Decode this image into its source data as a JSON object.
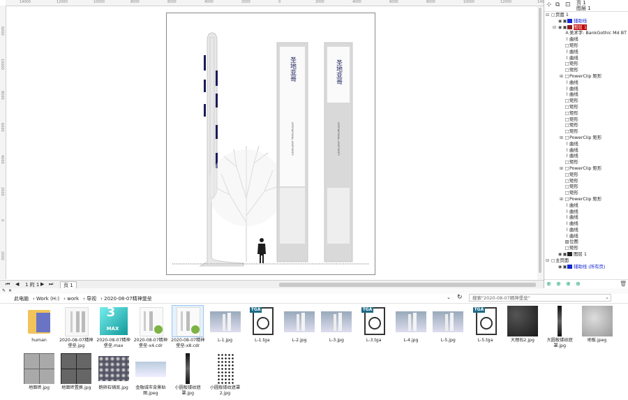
{
  "ruler": {
    "top_ticks": [
      "14000",
      "12000",
      "10000",
      "8000",
      "6000",
      "4000",
      "2000",
      "0",
      "2000",
      "4000",
      "6000",
      "8000",
      "10000",
      "12000",
      "14000"
    ],
    "left_ticks": [
      "6000",
      "10000",
      "8000",
      "6000",
      "4000",
      "2000",
      "0",
      "2000"
    ]
  },
  "navigator": {
    "page_counter": "1 的 1",
    "page_tab": "页 1"
  },
  "object_manager": {
    "page_label": "页 1",
    "layer_label": "图层 1",
    "rows": [
      {
        "indent": 0,
        "icon": "page",
        "label": "页面 1",
        "expand": "⊟"
      },
      {
        "indent": 1,
        "icon": "layer",
        "label": "辅助线",
        "swatch": "#1428d0",
        "color": "#1428d0"
      },
      {
        "indent": 1,
        "icon": "layer",
        "label": "图层 1",
        "swatch": "#8b1c1c",
        "color": "#c00",
        "expand": "⊟",
        "highlight": "#c00000"
      },
      {
        "indent": 2,
        "icon": "text",
        "label": "美术字: BankGothic Md BT"
      },
      {
        "indent": 2,
        "icon": "curve",
        "label": "曲线"
      },
      {
        "indent": 2,
        "icon": "rect",
        "label": "矩形"
      },
      {
        "indent": 2,
        "icon": "curve",
        "label": "曲线"
      },
      {
        "indent": 2,
        "icon": "curve",
        "label": "曲线"
      },
      {
        "indent": 2,
        "icon": "rect",
        "label": "矩形"
      },
      {
        "indent": 2,
        "icon": "rect",
        "label": "矩形"
      },
      {
        "indent": 2,
        "icon": "rect",
        "label": "PowerClip 矩形",
        "expand": "⊞"
      },
      {
        "indent": 2,
        "icon": "curve",
        "label": "曲线"
      },
      {
        "indent": 2,
        "icon": "curve",
        "label": "曲线"
      },
      {
        "indent": 2,
        "icon": "curve",
        "label": "曲线"
      },
      {
        "indent": 2,
        "icon": "rect",
        "label": "矩形"
      },
      {
        "indent": 2,
        "icon": "rect",
        "label": "矩形"
      },
      {
        "indent": 2,
        "icon": "rect",
        "label": "矩形"
      },
      {
        "indent": 2,
        "icon": "rect",
        "label": "矩形"
      },
      {
        "indent": 2,
        "icon": "rect",
        "label": "矩形"
      },
      {
        "indent": 2,
        "icon": "rect",
        "label": "矩形"
      },
      {
        "indent": 2,
        "icon": "rect",
        "label": "PowerClip 矩形",
        "expand": "⊞"
      },
      {
        "indent": 2,
        "icon": "curve",
        "label": "曲线"
      },
      {
        "indent": 2,
        "icon": "curve",
        "label": "曲线"
      },
      {
        "indent": 2,
        "icon": "curve",
        "label": "曲线"
      },
      {
        "indent": 2,
        "icon": "rect",
        "label": "矩形"
      },
      {
        "indent": 2,
        "icon": "rect",
        "label": "PowerClip 矩形",
        "expand": "⊞"
      },
      {
        "indent": 2,
        "icon": "rect",
        "label": "矩形"
      },
      {
        "indent": 2,
        "icon": "rect",
        "label": "矩形"
      },
      {
        "indent": 2,
        "icon": "rect",
        "label": "矩形"
      },
      {
        "indent": 2,
        "icon": "rect",
        "label": "矩形"
      },
      {
        "indent": 2,
        "icon": "rect",
        "label": "PowerClip 矩形",
        "expand": "⊞"
      },
      {
        "indent": 2,
        "icon": "curve",
        "label": "曲线"
      },
      {
        "indent": 2,
        "icon": "curve",
        "label": "曲线"
      },
      {
        "indent": 2,
        "icon": "curve",
        "label": "曲线"
      },
      {
        "indent": 2,
        "icon": "curve",
        "label": "曲线"
      },
      {
        "indent": 2,
        "icon": "curve",
        "label": "曲线"
      },
      {
        "indent": 2,
        "icon": "curve",
        "label": "曲线"
      },
      {
        "indent": 2,
        "icon": "bitmap",
        "label": "位图"
      },
      {
        "indent": 2,
        "icon": "rect",
        "label": "矩形"
      },
      {
        "indent": 1,
        "icon": "layer",
        "label": "图层 1",
        "swatch": "#222222"
      },
      {
        "indent": 0,
        "icon": "page",
        "label": "主页面",
        "expand": "⊟"
      },
      {
        "indent": 1,
        "icon": "layer",
        "label": "辅助线 (所有页)",
        "swatch": "#1428d0",
        "color": "#1428d0"
      }
    ]
  },
  "explorer": {
    "crumbs": [
      "此电脑",
      "Work (H:)",
      "work",
      "导视",
      "2020-08-07精神堡垒"
    ],
    "search_placeholder": "搜索\"2020-08-07精神堡垒\"",
    "files": [
      {
        "name": "human",
        "kind": "folder"
      },
      {
        "name": "2020-08-07精神堡垒.jpg",
        "kind": "jpg-sign"
      },
      {
        "name": "2020-08-07精神堡垒.max",
        "kind": "max"
      },
      {
        "name": "2020-08-07精神堡垒-x4.cdr",
        "kind": "cdr"
      },
      {
        "name": "2020-08-07精神堡垒-x8.cdr",
        "kind": "cdr",
        "selected": true
      },
      {
        "name": "L-1.jpg",
        "kind": "render"
      },
      {
        "name": "L-1.tga",
        "kind": "tga"
      },
      {
        "name": "L-2.jpg",
        "kind": "render"
      },
      {
        "name": "L-3.jpg",
        "kind": "render"
      },
      {
        "name": "L-3.tga",
        "kind": "tga"
      },
      {
        "name": "L-4.jpg",
        "kind": "render"
      },
      {
        "name": "L-5.jpg",
        "kind": "render"
      },
      {
        "name": "L-5.tga",
        "kind": "tga"
      },
      {
        "name": "大理石2.jpg",
        "kind": "marble-dark"
      },
      {
        "name": "大圆板镂纹遮罩.jpg",
        "kind": "strip"
      },
      {
        "name": "地板.jpeg",
        "kind": "marble-light"
      },
      {
        "name": "地面砖.jpg",
        "kind": "tile"
      },
      {
        "name": "地面砖置换.jpg",
        "kind": "tile-dark"
      },
      {
        "name": "鹅卵石铺底.jpg",
        "kind": "pebble"
      },
      {
        "name": "金融城市背景贴图.jpeg",
        "kind": "city"
      },
      {
        "name": "小圆板镂纹遮罩.jpg",
        "kind": "strip"
      },
      {
        "name": "小圆板镂纹遮罩2.jpg",
        "kind": "dots"
      }
    ]
  },
  "sign": {
    "logo_text": "圣地亚哥",
    "subtitle": "INTERNATIONAL APARTMENTS"
  }
}
